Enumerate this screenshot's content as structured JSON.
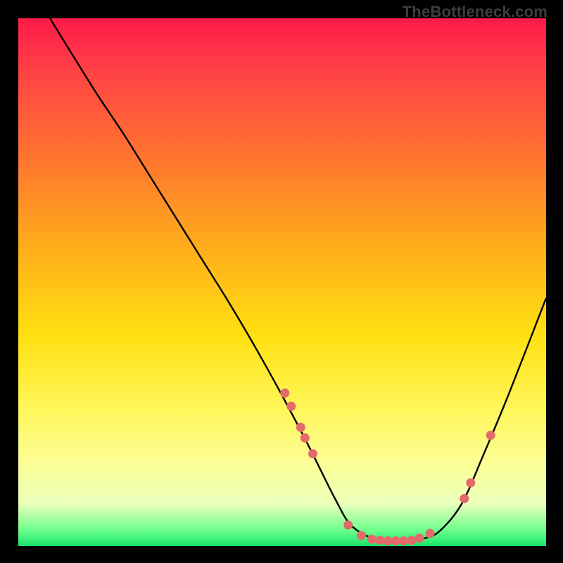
{
  "watermark": "TheBottleneck.com",
  "chart_data": {
    "type": "line",
    "title": "",
    "xlabel": "",
    "ylabel": "",
    "xlim": [
      0,
      100
    ],
    "ylim": [
      0,
      100
    ],
    "series": [
      {
        "name": "curve",
        "x": [
          6,
          10,
          15,
          20,
          25,
          30,
          35,
          40,
          45,
          50,
          55,
          60,
          63,
          67,
          70,
          73,
          77,
          80,
          84,
          88,
          93,
          100
        ],
        "y": [
          100,
          93.5,
          85.5,
          78,
          70,
          62,
          54,
          46,
          37.5,
          28.5,
          19,
          9,
          4,
          1.5,
          1,
          1,
          1.5,
          3,
          8,
          17,
          29,
          47
        ]
      }
    ],
    "markers": [
      {
        "x": 50.5,
        "y": 29.0
      },
      {
        "x": 51.7,
        "y": 26.5
      },
      {
        "x": 53.5,
        "y": 22.5
      },
      {
        "x": 54.3,
        "y": 20.5
      },
      {
        "x": 55.8,
        "y": 17.5
      },
      {
        "x": 62.5,
        "y": 4.0
      },
      {
        "x": 65.0,
        "y": 2.0
      },
      {
        "x": 67.0,
        "y": 1.3
      },
      {
        "x": 68.5,
        "y": 1.1
      },
      {
        "x": 70.0,
        "y": 1.0
      },
      {
        "x": 71.5,
        "y": 1.0
      },
      {
        "x": 73.0,
        "y": 1.0
      },
      {
        "x": 74.5,
        "y": 1.1
      },
      {
        "x": 76.0,
        "y": 1.5
      },
      {
        "x": 78.0,
        "y": 2.4
      },
      {
        "x": 84.5,
        "y": 9.0
      },
      {
        "x": 85.7,
        "y": 12.0
      },
      {
        "x": 89.5,
        "y": 21.0
      }
    ],
    "marker_color": "#e36a6a",
    "curve_color": "#000000",
    "annotations": []
  }
}
